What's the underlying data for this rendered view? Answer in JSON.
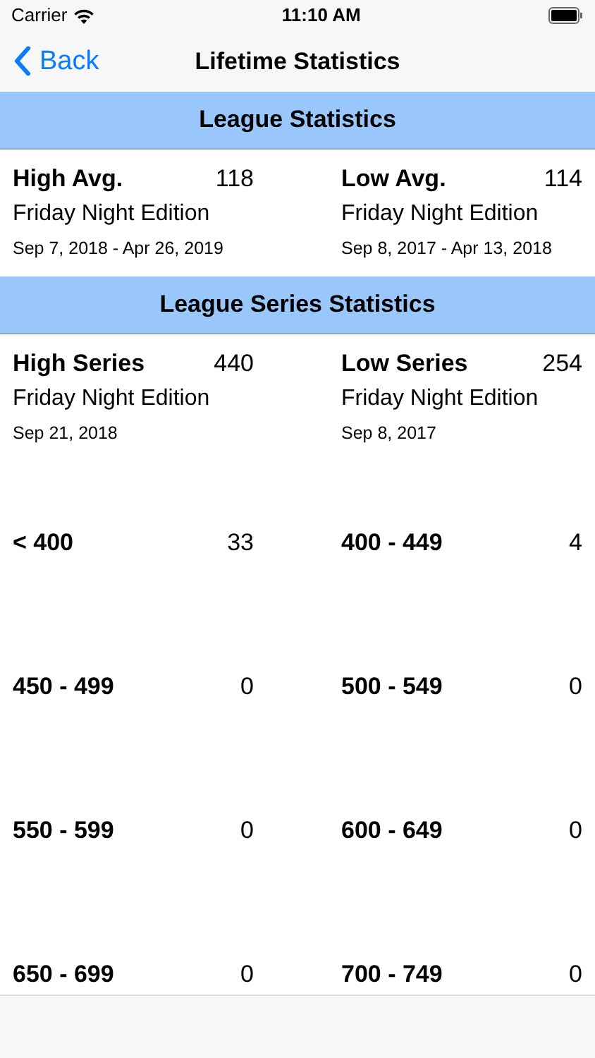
{
  "status_bar": {
    "carrier": "Carrier",
    "time": "11:10 AM"
  },
  "nav_bar": {
    "back": "Back",
    "title": "Lifetime Statistics"
  },
  "sections": [
    {
      "title": "League Statistics",
      "cells": [
        {
          "label": "High Avg.",
          "value": "118",
          "league": "Friday Night Edition",
          "dates": "Sep 7, 2018 - Apr 26, 2019"
        },
        {
          "label": "Low Avg.",
          "value": "114",
          "league": "Friday Night Edition",
          "dates": "Sep 8, 2017 - Apr 13, 2018"
        }
      ]
    },
    {
      "title": "League Series Statistics",
      "cells": [
        {
          "label": "High Series",
          "value": "440",
          "league": "Friday Night Edition",
          "dates": "Sep 21, 2018"
        },
        {
          "label": "Low Series",
          "value": "254",
          "league": "Friday Night Edition",
          "dates": "Sep 8, 2017"
        }
      ],
      "ranges": [
        [
          {
            "label": "< 400",
            "value": "33"
          },
          {
            "label": "400 - 449",
            "value": "4"
          }
        ],
        [
          {
            "label": "450 - 499",
            "value": "0"
          },
          {
            "label": "500 - 549",
            "value": "0"
          }
        ],
        [
          {
            "label": "550 - 599",
            "value": "0"
          },
          {
            "label": "600 - 649",
            "value": "0"
          }
        ],
        [
          {
            "label": "650 - 699",
            "value": "0"
          },
          {
            "label": "700 - 749",
            "value": "0"
          }
        ]
      ]
    }
  ]
}
